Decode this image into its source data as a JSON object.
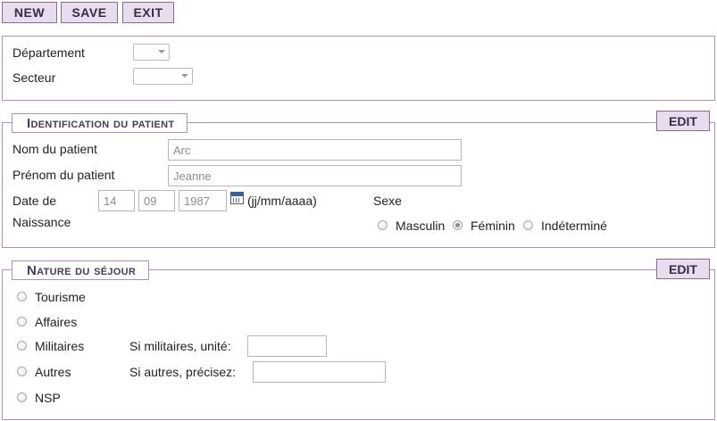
{
  "toolbar": {
    "new_label": "NEW",
    "save_label": "SAVE",
    "exit_label": "EXIT"
  },
  "location": {
    "departement_label": "Département",
    "departement_value": "",
    "secteur_label": "Secteur",
    "secteur_value": ""
  },
  "patient": {
    "section_title": "Identification du patient",
    "edit_label": "EDIT",
    "nom_label": "Nom du patient",
    "nom_value": "Arc",
    "prenom_label": "Prénom du patient",
    "prenom_value": "Jeanne",
    "date_label_line1": "Date de",
    "date_label_line2": "Naissance",
    "date_day": "14",
    "date_month": "09",
    "date_year": "1987",
    "date_format": "(jj/mm/aaaa)",
    "sexe_label": "Sexe",
    "sexe_options": [
      "Masculin",
      "Féminin",
      "Indéterminé"
    ],
    "sexe_selected": "Féminin"
  },
  "sejour": {
    "section_title": "Nature du séjour",
    "edit_label": "EDIT",
    "options": [
      "Tourisme",
      "Affaires",
      "Militaires",
      "Autres",
      "NSP"
    ],
    "militaires_unit_label": "Si militaires, unité:",
    "militaires_unit_value": "",
    "autres_label": "Si autres, précisez:",
    "autres_value": ""
  },
  "icons": {
    "calendar": "calendar-icon",
    "dropdown": "chevron-down-icon"
  }
}
